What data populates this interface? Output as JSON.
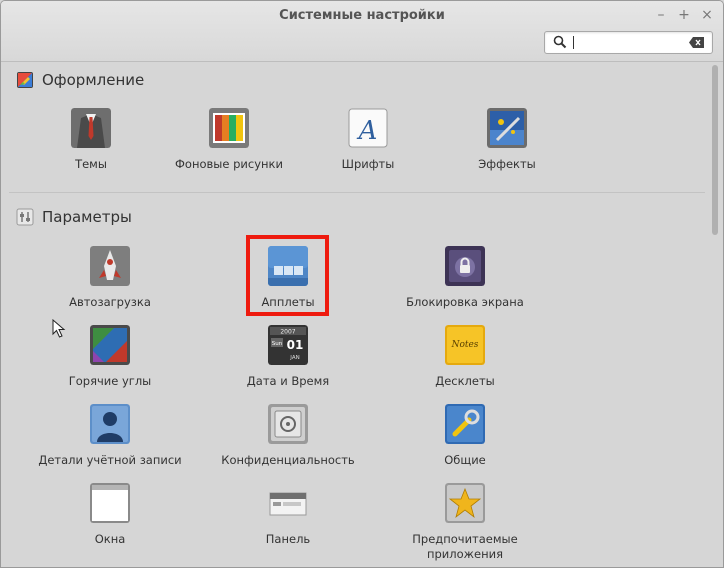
{
  "window": {
    "title": "Системные настройки",
    "controls": [
      "–",
      "+",
      "×"
    ]
  },
  "search": {
    "value": ""
  },
  "sections": [
    {
      "title": "Оформление",
      "items": [
        {
          "label": "Темы",
          "icon": "themes-icon"
        },
        {
          "label": "Фоновые рисунки",
          "icon": "backgrounds-icon"
        },
        {
          "label": "Шрифты",
          "icon": "fonts-icon"
        },
        {
          "label": "Эффекты",
          "icon": "effects-icon"
        }
      ]
    },
    {
      "title": "Параметры",
      "items": [
        {
          "label": "Автозагрузка",
          "icon": "startup-icon"
        },
        {
          "label": "Апплеты",
          "icon": "applets-icon",
          "highlighted": true
        },
        {
          "label": "Блокировка экрана",
          "icon": "lock-screen-icon"
        },
        {
          "label": "Горячие углы",
          "icon": "hot-corners-icon"
        },
        {
          "label": "Дата и Время",
          "icon": "date-time-icon"
        },
        {
          "label": "Десклеты",
          "icon": "desklets-icon"
        },
        {
          "label": "Детали учётной записи",
          "icon": "account-icon"
        },
        {
          "label": "Конфиденциальность",
          "icon": "privacy-icon"
        },
        {
          "label": "Общие",
          "icon": "general-icon"
        },
        {
          "label": "Окна",
          "icon": "windows-icon"
        },
        {
          "label": "Панель",
          "icon": "panel-icon"
        },
        {
          "label": "Предпочитаемые\nприложения",
          "icon": "preferred-apps-icon"
        }
      ]
    }
  ],
  "calendar_icon": {
    "year": "2007",
    "day": "01",
    "weekday": "Sun",
    "month": "JAN"
  },
  "desklets_icon_text": "Notes",
  "colors": {
    "highlight": "#ee1b0f",
    "background": "#d6d6d6"
  }
}
